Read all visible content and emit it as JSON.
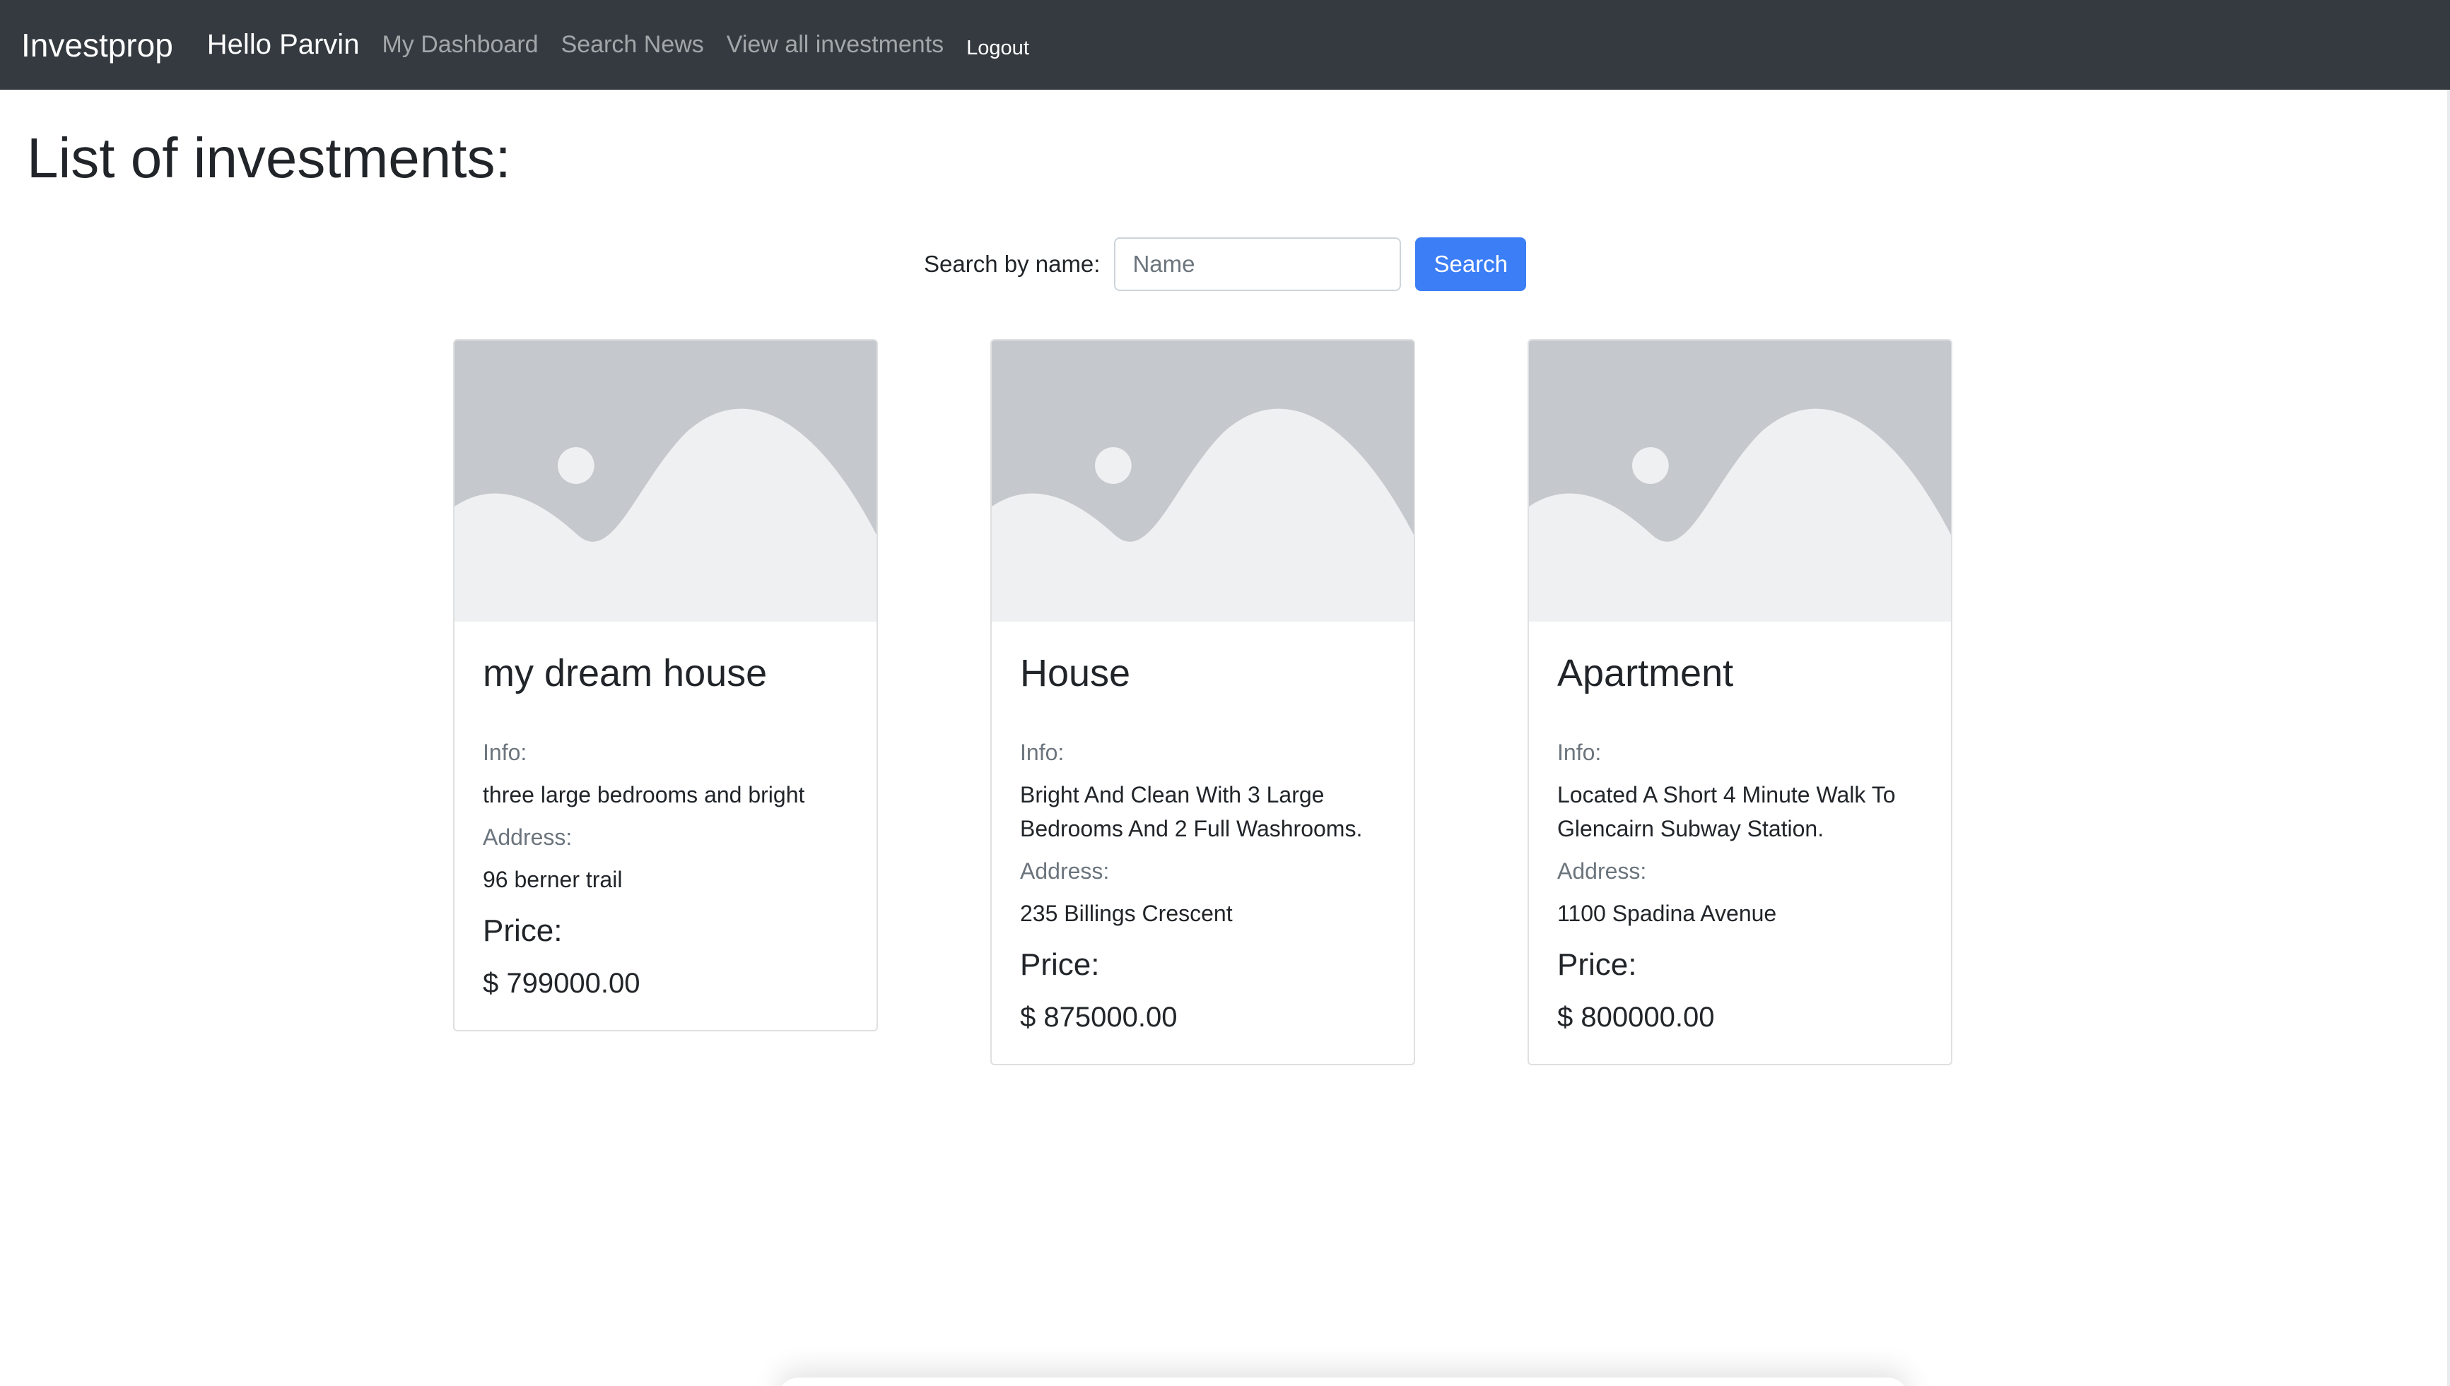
{
  "navbar": {
    "brand": "Investprop",
    "greeting": "Hello Parvin",
    "links": [
      "My Dashboard",
      "Search News",
      "View all investments"
    ],
    "logout_label": "Logout"
  },
  "page_title": "List of investments:",
  "search": {
    "label": "Search by name:",
    "placeholder": "Name",
    "value": "",
    "button_label": "Search"
  },
  "investments": [
    {
      "name": "my dream house",
      "info_label": "Info:",
      "info": "three large bedrooms and bright",
      "address_label": "Address:",
      "address": "96 berner trail",
      "price_label": "Price:",
      "price": "$ 799000.00"
    },
    {
      "name": "House",
      "info_label": "Info:",
      "info": "Bright And Clean With 3 Large Bedrooms And 2 Full Washrooms.",
      "address_label": "Address:",
      "address": "235 Billings Crescent",
      "price_label": "Price:",
      "price": "$ 875000.00"
    },
    {
      "name": "Apartment",
      "info_label": "Info:",
      "info": "Located A Short 4 Minute Walk To Glencairn Subway Station.",
      "address_label": "Address:",
      "address": "1100 Spadina Avenue",
      "price_label": "Price:",
      "price": "$ 800000.00"
    }
  ],
  "colors": {
    "navbar_bg": "#343a40",
    "primary_button": "#3b7ef6",
    "image_placeholder_bg": "#c5c8cd",
    "image_placeholder_fg": "#eff0f1"
  },
  "icons": {
    "card_image": "image-placeholder-icon"
  }
}
